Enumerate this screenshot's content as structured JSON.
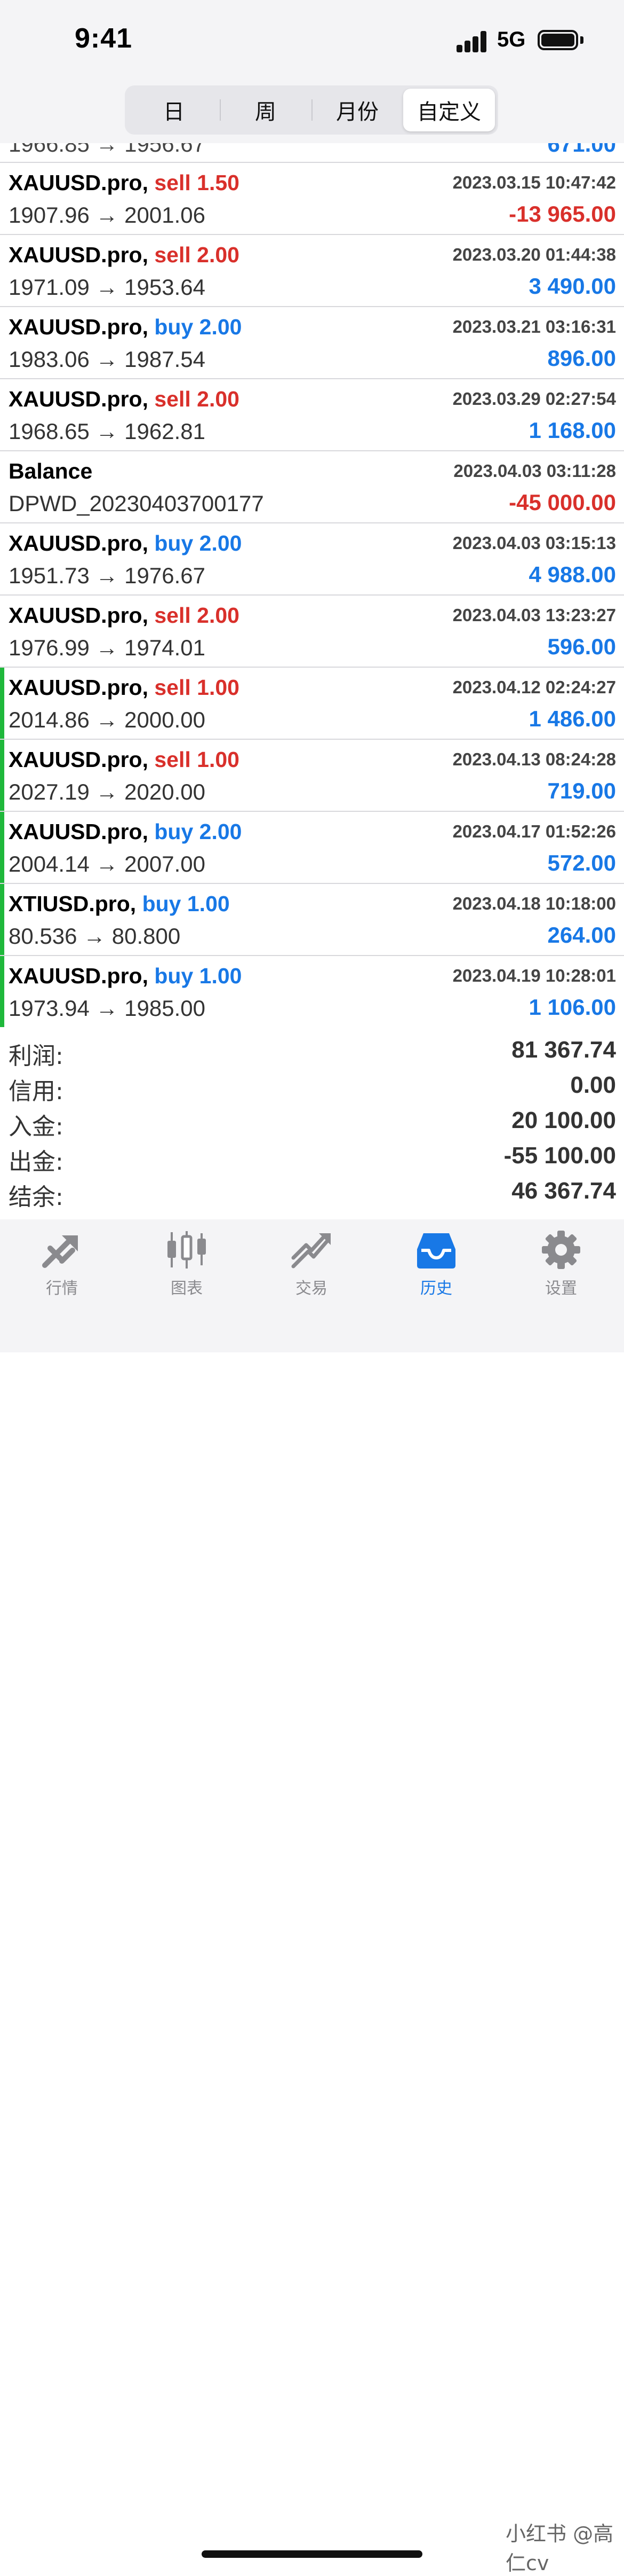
{
  "status": {
    "time": "9:41",
    "network": "5G"
  },
  "segments": [
    "日",
    "周",
    "月份",
    "自定义"
  ],
  "partial_row": {
    "line2": "1966.85 → 1956.67",
    "profit": "671.00"
  },
  "rows": [
    {
      "symbol": "XAUUSD.pro,",
      "side": "sell 1.50",
      "side_color": "#d9302b",
      "date": "2023.03.15 10:47:42",
      "prices": "1907.96 → 2001.06",
      "profit": "-13 965.00",
      "profit_color": "#d9302b",
      "marker": false
    },
    {
      "symbol": "XAUUSD.pro,",
      "side": "sell 2.00",
      "side_color": "#d9302b",
      "date": "2023.03.20 01:44:38",
      "prices": "1971.09 → 1953.64",
      "profit": "3 490.00",
      "profit_color": "#1878e6",
      "marker": false
    },
    {
      "symbol": "XAUUSD.pro,",
      "side": "buy 2.00",
      "side_color": "#1878e6",
      "date": "2023.03.21 03:16:31",
      "prices": "1983.06 → 1987.54",
      "profit": "896.00",
      "profit_color": "#1878e6",
      "marker": false
    },
    {
      "symbol": "XAUUSD.pro,",
      "side": "sell 2.00",
      "side_color": "#d9302b",
      "date": "2023.03.29 02:27:54",
      "prices": "1968.65 → 1962.81",
      "profit": "1 168.00",
      "profit_color": "#1878e6",
      "marker": false
    },
    {
      "symbol": "Balance",
      "side": "",
      "side_color": "#000000",
      "date": "2023.04.03 03:11:28",
      "prices": "DPWD_20230403700177",
      "profit": "-45 000.00",
      "profit_color": "#d9302b",
      "marker": false
    },
    {
      "symbol": "XAUUSD.pro,",
      "side": "buy 2.00",
      "side_color": "#1878e6",
      "date": "2023.04.03 03:15:13",
      "prices": "1951.73 → 1976.67",
      "profit": "4 988.00",
      "profit_color": "#1878e6",
      "marker": false
    },
    {
      "symbol": "XAUUSD.pro,",
      "side": "sell 2.00",
      "side_color": "#d9302b",
      "date": "2023.04.03 13:23:27",
      "prices": "1976.99 → 1974.01",
      "profit": "596.00",
      "profit_color": "#1878e6",
      "marker": false
    },
    {
      "symbol": "XAUUSD.pro,",
      "side": "sell 1.00",
      "side_color": "#d9302b",
      "date": "2023.04.12 02:24:27",
      "prices": "2014.86 → 2000.00",
      "profit": "1 486.00",
      "profit_color": "#1878e6",
      "marker": true
    },
    {
      "symbol": "XAUUSD.pro,",
      "side": "sell 1.00",
      "side_color": "#d9302b",
      "date": "2023.04.13 08:24:28",
      "prices": "2027.19 → 2020.00",
      "profit": "719.00",
      "profit_color": "#1878e6",
      "marker": true
    },
    {
      "symbol": "XAUUSD.pro,",
      "side": "buy 2.00",
      "side_color": "#1878e6",
      "date": "2023.04.17 01:52:26",
      "prices": "2004.14 → 2007.00",
      "profit": "572.00",
      "profit_color": "#1878e6",
      "marker": true
    },
    {
      "symbol": "XTIUSD.pro,",
      "side": "buy 1.00",
      "side_color": "#1878e6",
      "date": "2023.04.18 10:18:00",
      "prices": "80.536 → 80.800",
      "profit": "264.00",
      "profit_color": "#1878e6",
      "marker": true
    },
    {
      "symbol": "XAUUSD.pro,",
      "side": "buy 1.00",
      "side_color": "#1878e6",
      "date": "2023.04.19 10:28:01",
      "prices": "1973.94 → 1985.00",
      "profit": "1 106.00",
      "profit_color": "#1878e6",
      "marker": true
    }
  ],
  "summary": [
    {
      "label": "利润:",
      "value": "81 367.74"
    },
    {
      "label": "信用:",
      "value": "0.00"
    },
    {
      "label": "入金:",
      "value": "20 100.00"
    },
    {
      "label": "出金:",
      "value": "-55 100.00"
    },
    {
      "label": "结余:",
      "value": "46 367.74"
    }
  ],
  "tabs": [
    {
      "label": "行情",
      "icon": "quotes-icon",
      "active": false
    },
    {
      "label": "图表",
      "icon": "chart-icon",
      "active": false
    },
    {
      "label": "交易",
      "icon": "trade-icon",
      "active": false
    },
    {
      "label": "历史",
      "icon": "history-icon",
      "active": true
    },
    {
      "label": "设置",
      "icon": "gear-icon",
      "active": false
    }
  ],
  "watermark": "小红书 @高仁cv",
  "colors": {
    "sell": "#d9302b",
    "buy": "#1878e6",
    "marker": "#1fb83b",
    "active_tab": "#1878e6"
  }
}
